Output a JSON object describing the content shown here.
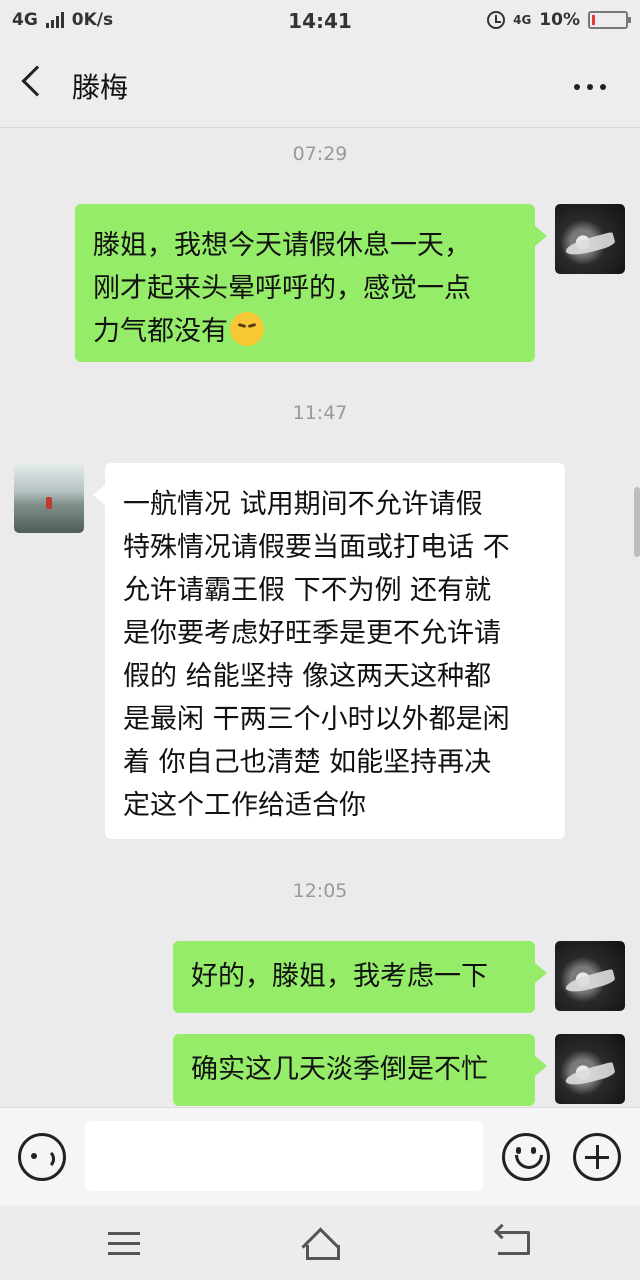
{
  "status_bar": {
    "network": "4G",
    "speed": "0K/s",
    "time": "14:41",
    "net_secondary": "4G",
    "battery": "10%",
    "battery_level": 0.1
  },
  "header": {
    "title": "滕梅"
  },
  "messages": [
    {
      "type": "timestamp",
      "text": "07:29"
    },
    {
      "type": "message",
      "sender": "me",
      "lines": [
        "滕姐，我想今天请假休息一天，",
        "刚才起来头晕呼呼的，感觉一点",
        "力气都没有"
      ],
      "emoji": "pensive-face-emoji"
    },
    {
      "type": "timestamp",
      "text": "11:47"
    },
    {
      "type": "message",
      "sender": "them",
      "lines": [
        "一航情况  试用期间不允许请假",
        "特殊情况请假要当面或打电话  不",
        "允许请霸王假  下不为例  还有就",
        "是你要考虑好旺季是更不允许请",
        "假的  给能坚持  像这两天这种都",
        "是最闲  干两三个小时以外都是闲",
        "着  你自己也清楚  如能坚持再决",
        "定这个工作给适合你"
      ]
    },
    {
      "type": "timestamp",
      "text": "12:05"
    },
    {
      "type": "message",
      "sender": "me",
      "lines": [
        "好的，滕姐，我考虑一下"
      ]
    },
    {
      "type": "message",
      "sender": "me",
      "lines": [
        "确实这几天淡季倒是不忙"
      ]
    }
  ],
  "input_bar": {
    "voice_icon": "voice-icon",
    "emoji_icon": "emoji-icon",
    "plus_icon": "plus-icon"
  },
  "colors": {
    "my_bubble": "#95ec69",
    "their_bubble": "#ffffff",
    "background": "#ebebeb",
    "battery_low": "#e53935"
  }
}
